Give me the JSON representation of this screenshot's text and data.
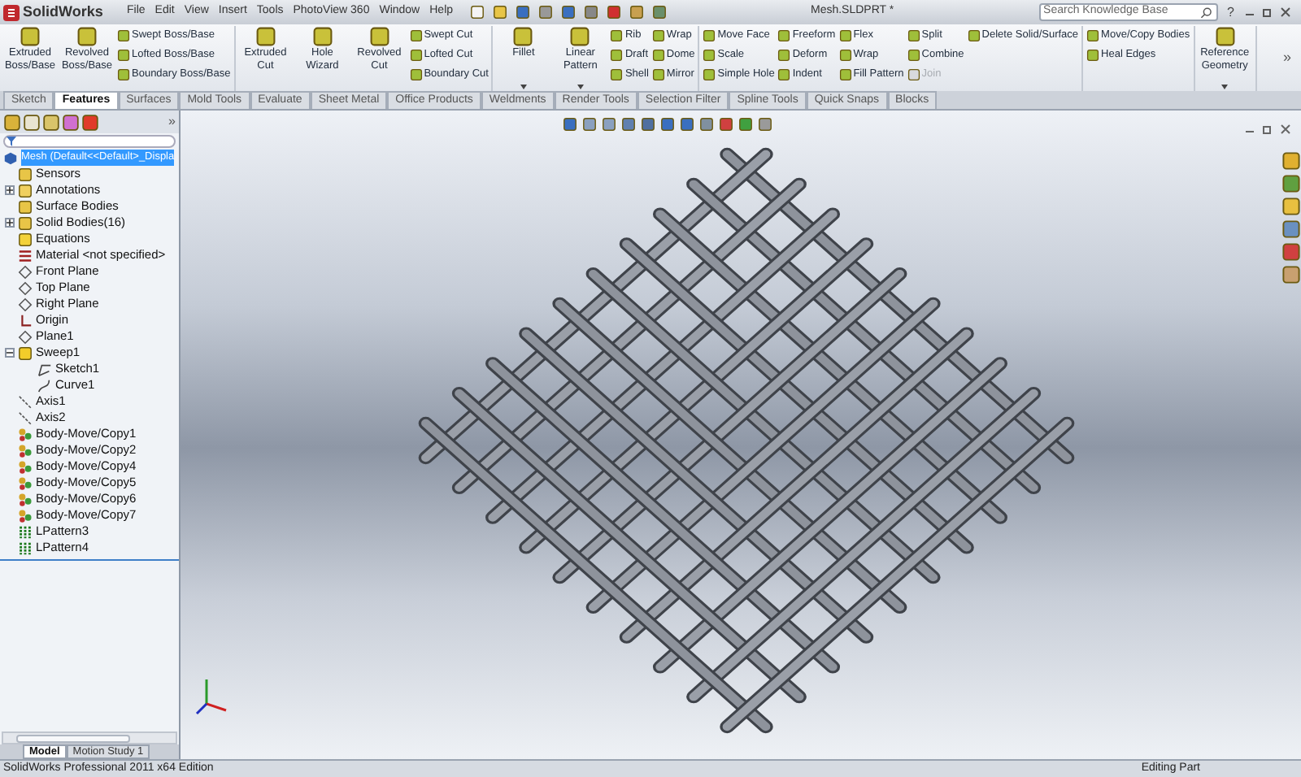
{
  "title_bar": {
    "app_name": "SolidWorks",
    "menus": [
      "File",
      "Edit",
      "View",
      "Insert",
      "Tools",
      "PhotoView 360",
      "Window",
      "Help"
    ],
    "document_title": "Mesh.SLDPRT *",
    "search": {
      "placeholder": "Search Knowledge Base"
    },
    "help": "?"
  },
  "ribbon": {
    "groups": [
      {
        "columns": [
          [
            {
              "label": "Extruded Boss/Base",
              "kind": "large"
            }
          ],
          [
            {
              "label": "Revolved Boss/Base",
              "kind": "large"
            }
          ],
          [
            {
              "label": "Swept Boss/Base",
              "kind": "small"
            },
            {
              "label": "Lofted Boss/Base",
              "kind": "small"
            },
            {
              "label": "Boundary Boss/Base",
              "kind": "small"
            }
          ]
        ]
      },
      {
        "columns": [
          [
            {
              "label": "Extruded Cut",
              "kind": "large"
            }
          ],
          [
            {
              "label": "Hole Wizard",
              "kind": "large"
            }
          ],
          [
            {
              "label": "Revolved Cut",
              "kind": "large"
            }
          ],
          [
            {
              "label": "Swept Cut",
              "kind": "small"
            },
            {
              "label": "Lofted Cut",
              "kind": "small"
            },
            {
              "label": "Boundary Cut",
              "kind": "small"
            }
          ]
        ]
      },
      {
        "columns": [
          [
            {
              "label": "Fillet",
              "kind": "large",
              "dropdown": true
            }
          ],
          [
            {
              "label": "Linear Pattern",
              "kind": "large",
              "dropdown": true
            }
          ],
          [
            {
              "label": "Rib",
              "kind": "small"
            },
            {
              "label": "Draft",
              "kind": "small"
            },
            {
              "label": "Shell",
              "kind": "small"
            }
          ],
          [
            {
              "label": "Wrap",
              "kind": "small"
            },
            {
              "label": "Dome",
              "kind": "small"
            },
            {
              "label": "Mirror",
              "kind": "small"
            }
          ]
        ]
      },
      {
        "columns": [
          [
            {
              "label": "Move Face",
              "kind": "small"
            },
            {
              "label": "Scale",
              "kind": "small"
            },
            {
              "label": "Simple Hole",
              "kind": "small"
            }
          ],
          [
            {
              "label": "Freeform",
              "kind": "small"
            },
            {
              "label": "Deform",
              "kind": "small"
            },
            {
              "label": "Indent",
              "kind": "small"
            }
          ],
          [
            {
              "label": "Flex",
              "kind": "small"
            },
            {
              "label": "Wrap",
              "kind": "small"
            },
            {
              "label": "Fill Pattern",
              "kind": "small"
            }
          ],
          [
            {
              "label": "Split",
              "kind": "small"
            },
            {
              "label": "Combine",
              "kind": "small"
            },
            {
              "label": "Join",
              "kind": "small",
              "disabled": true
            }
          ],
          [
            {
              "label": "Delete Solid/Surface",
              "kind": "small"
            }
          ]
        ]
      },
      {
        "columns": [
          [
            {
              "label": "Move/Copy Bodies",
              "kind": "small"
            },
            {
              "label": "Heal Edges",
              "kind": "small"
            }
          ]
        ]
      },
      {
        "columns": [
          [
            {
              "label": "Reference Geometry",
              "kind": "large",
              "dropdown": true
            }
          ]
        ]
      }
    ],
    "more": "»"
  },
  "tabs": [
    {
      "label": "Sketch",
      "selected": false
    },
    {
      "label": "Features",
      "selected": true
    },
    {
      "label": "Surfaces",
      "selected": false
    },
    {
      "label": "Mold Tools",
      "selected": false
    },
    {
      "label": "Evaluate",
      "selected": false
    },
    {
      "label": "Sheet Metal",
      "selected": false
    },
    {
      "label": "Office Products",
      "selected": false
    },
    {
      "label": "Weldments",
      "selected": false
    },
    {
      "label": "Render Tools",
      "selected": false
    },
    {
      "label": "Selection Filter",
      "selected": false
    },
    {
      "label": "Spline Tools",
      "selected": false
    },
    {
      "label": "Quick Snaps",
      "selected": false
    },
    {
      "label": "Blocks",
      "selected": false
    }
  ],
  "feature_tree": {
    "more": "»",
    "root": {
      "label": "Mesh  (Default<<Default>_Displa",
      "selected": true
    },
    "items": [
      {
        "label": "Sensors",
        "kind": "folder"
      },
      {
        "label": "Annotations",
        "kind": "annotation",
        "expanded": false
      },
      {
        "label": "Surface Bodies",
        "kind": "folder"
      },
      {
        "label": "Solid Bodies(16)",
        "kind": "folder",
        "expanded": false
      },
      {
        "label": "Equations",
        "kind": "equation"
      },
      {
        "label": "Material <not specified>",
        "kind": "material"
      },
      {
        "label": "Front Plane",
        "kind": "plane"
      },
      {
        "label": "Top Plane",
        "kind": "plane"
      },
      {
        "label": "Right Plane",
        "kind": "plane"
      },
      {
        "label": "Origin",
        "kind": "origin"
      },
      {
        "label": "Plane1",
        "kind": "plane"
      },
      {
        "label": "Sweep1",
        "kind": "sweep",
        "expanded": true,
        "children": [
          {
            "label": "Sketch1",
            "kind": "sketch"
          },
          {
            "label": "Curve1",
            "kind": "curve"
          }
        ]
      },
      {
        "label": "Axis1",
        "kind": "axis"
      },
      {
        "label": "Axis2",
        "kind": "axis"
      },
      {
        "label": "Body-Move/Copy1",
        "kind": "body"
      },
      {
        "label": "Body-Move/Copy2",
        "kind": "body"
      },
      {
        "label": "Body-Move/Copy4",
        "kind": "body"
      },
      {
        "label": "Body-Move/Copy5",
        "kind": "body"
      },
      {
        "label": "Body-Move/Copy6",
        "kind": "body"
      },
      {
        "label": "Body-Move/Copy7",
        "kind": "body"
      },
      {
        "label": "LPattern3",
        "kind": "pattern"
      },
      {
        "label": "LPattern4",
        "kind": "pattern"
      }
    ]
  },
  "bottom_tabs": [
    {
      "label": "Model",
      "selected": true
    },
    {
      "label": "Motion Study 1",
      "selected": false
    }
  ],
  "status_bar": {
    "edition": "SolidWorks Professional 2011 x64 Edition",
    "mode": "Editing Part"
  }
}
